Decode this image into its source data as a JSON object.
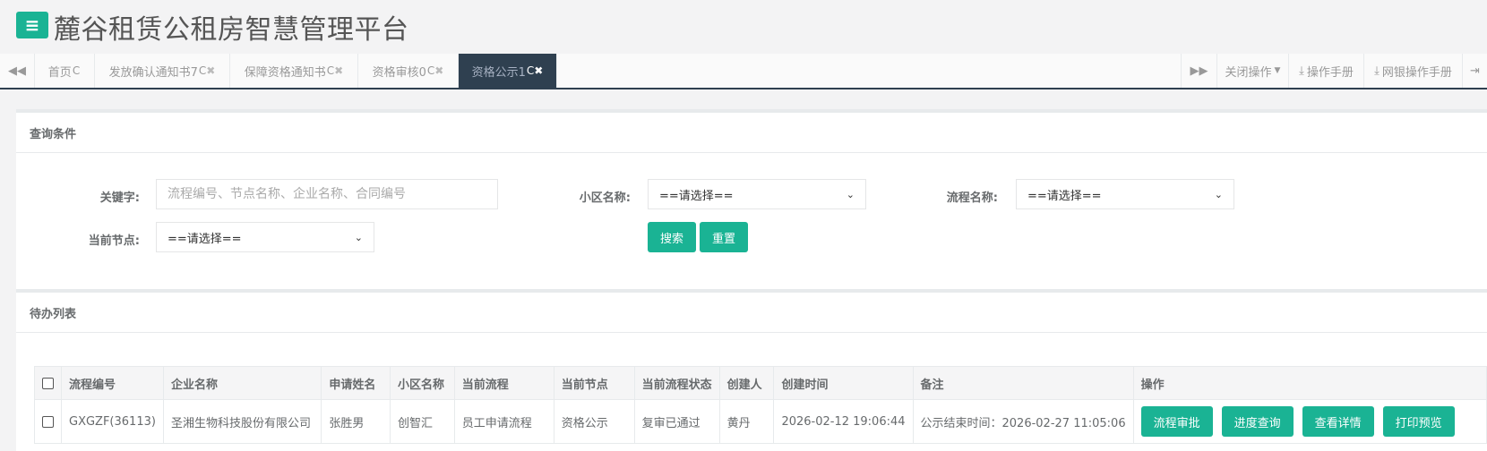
{
  "header": {
    "menu_icon": "menu-icon",
    "title": "麓谷租赁公租房智慧管理平台"
  },
  "tabs": {
    "left_arrow_icon": "double-left-arrow-icon",
    "right_arrow_icon": "double-right-arrow-icon",
    "items": [
      {
        "label": "首页",
        "refresh": "C",
        "close": ""
      },
      {
        "label": "发放确认通知书7",
        "refresh": "C",
        "close": "✖"
      },
      {
        "label": "保障资格通知书",
        "refresh": "C",
        "close": "✖"
      },
      {
        "label": "资格审核0",
        "refresh": "C",
        "close": "✖"
      },
      {
        "label": "资格公示1",
        "refresh": "C",
        "close": "✖",
        "active": true
      }
    ],
    "close_ops": "关闭操作",
    "manual": "操作手册",
    "bank_manual": "网银操作手册"
  },
  "query": {
    "title": "查询条件",
    "keyword_label": "关键字:",
    "keyword_value": "",
    "keyword_placeholder": "流程编号、节点名称、企业名称、合同编号",
    "community_label": "小区名称:",
    "community_value": "==请选择==",
    "process_label": "流程名称:",
    "process_value": "==请选择==",
    "node_label": "当前节点:",
    "node_value": "==请选择==",
    "search_btn": "搜索",
    "reset_btn": "重置"
  },
  "todo": {
    "title": "待办列表",
    "columns": [
      "流程编号",
      "企业名称",
      "申请姓名",
      "小区名称",
      "当前流程",
      "当前节点",
      "当前流程状态",
      "创建人",
      "创建时间",
      "备注",
      "操作"
    ],
    "rows": [
      {
        "cells": [
          "GXGZF(36113)",
          "圣湘生物科技股份有限公司",
          "张胜男",
          "创智汇",
          "员工申请流程",
          "资格公示",
          "复审已通过",
          "黄丹",
          "2026-02-12 19:06:44",
          "公示结束时间：2026-02-27 11:05:06"
        ],
        "actions": [
          "流程审批",
          "进度查询",
          "查看详情",
          "打印预览"
        ]
      }
    ]
  },
  "colors": {
    "accent": "#1ab394",
    "dark_tab": "#2f4050"
  }
}
